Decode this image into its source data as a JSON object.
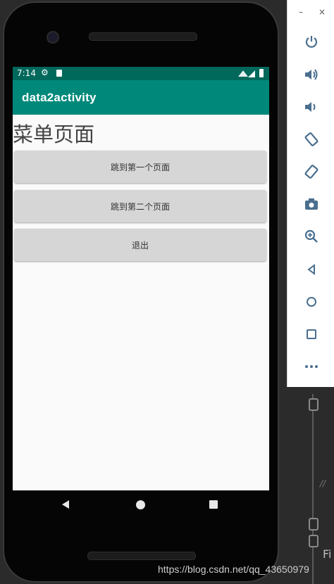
{
  "status_bar": {
    "time": "7:14"
  },
  "app_bar": {
    "title": "data2activity"
  },
  "page": {
    "heading": "菜单页面"
  },
  "buttons": {
    "first": "跳到第一个页面",
    "second": "跳到第二个页面",
    "exit": "退出"
  },
  "emulator": {
    "minimize": "–",
    "close": "×",
    "tools": [
      "power-icon",
      "volume-up-icon",
      "volume-down-icon",
      "rotate-left-icon",
      "rotate-right-icon",
      "camera-icon",
      "zoom-icon",
      "back-icon",
      "home-icon",
      "overview-icon",
      "more-icon"
    ]
  },
  "ide": {
    "partial_text": "Fi",
    "comment": "//"
  },
  "watermark": "https://blog.csdn.net/qq_43650979",
  "colors": {
    "status_bar": "#00695c",
    "app_bar": "#00897b",
    "button": "#d6d6d6",
    "screen_bg": "#fafafa"
  }
}
